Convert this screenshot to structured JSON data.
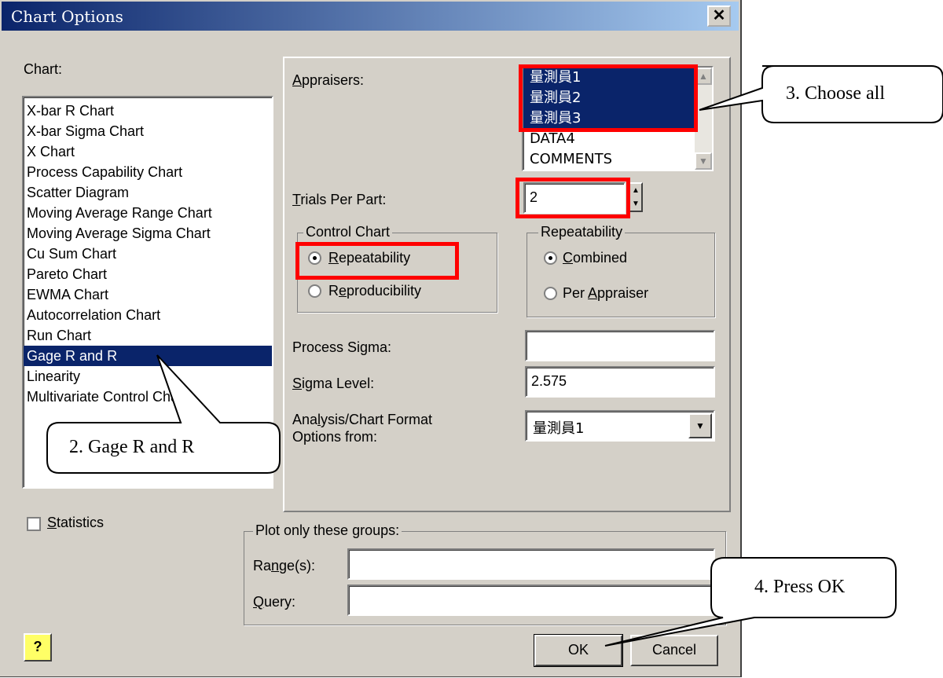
{
  "window": {
    "title": "Chart Options",
    "close_glyph": "✕"
  },
  "chart": {
    "label": "Chart:",
    "items": [
      "X-bar R Chart",
      "X-bar Sigma Chart",
      "X Chart",
      "Process Capability Chart",
      "Scatter Diagram",
      "Moving Average Range Chart",
      "Moving Average Sigma Chart",
      "Cu Sum Chart",
      "Pareto Chart",
      "EWMA Chart",
      "Autocorrelation Chart",
      "Run Chart",
      "Gage R and R",
      "Linearity",
      "Multivariate Control Chart"
    ],
    "selected": "Gage R and R"
  },
  "appraisers": {
    "label": "Appraisers:",
    "items": [
      "量測員1",
      "量測員2",
      "量測員3",
      "DATA4",
      "COMMENTS"
    ],
    "selected_count": 3
  },
  "trials": {
    "label": "Trials Per Part:",
    "value": "2"
  },
  "control_chart": {
    "label": "Control Chart",
    "options": [
      "Repeatability",
      "Reproducibility"
    ],
    "selected": "Repeatability"
  },
  "repeatability": {
    "label": "Repeatability",
    "options": [
      "Combined",
      "Per Appraiser"
    ],
    "selected": "Combined"
  },
  "process_sigma": {
    "label": "Process Sigma:",
    "value": ""
  },
  "sigma_level": {
    "label": "Sigma Level:",
    "value": "2.575"
  },
  "format_options": {
    "label_line1": "Analysis/Chart Format",
    "label_line2": "Options from:",
    "value": "量測員1"
  },
  "statistics": {
    "label": "Statistics",
    "checked": false
  },
  "plot_groups": {
    "label": "Plot only these groups:",
    "range_label": "Range(s):",
    "range_value": "",
    "query_label": "Query:",
    "query_value": ""
  },
  "buttons": {
    "help": "?",
    "ok": "OK",
    "cancel": "Cancel"
  },
  "callouts": {
    "choose_all": "3. Choose all",
    "gage": "2. Gage R and R",
    "press_ok": "4. Press OK"
  },
  "colors": {
    "selection": "#0a246a",
    "highlight_box": "#ff0000",
    "dialog_bg": "#d4d0c8"
  }
}
